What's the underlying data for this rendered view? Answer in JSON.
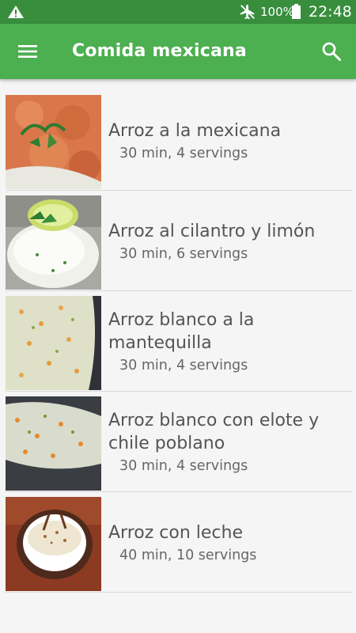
{
  "status_bar": {
    "battery_percent": "100%",
    "time": "22:48",
    "icons": [
      "warning-icon",
      "airplane-mode-icon",
      "battery-full-icon"
    ]
  },
  "app_bar": {
    "title": "Comida mexicana",
    "icons": [
      "menu-icon",
      "search-icon"
    ]
  },
  "colors": {
    "status_bar": "#388e3c",
    "app_bar": "#4caf50",
    "background": "#f5f5f5"
  },
  "recipes": [
    {
      "name": "Arroz a la mexicana",
      "meta": "30 min, 4 servings"
    },
    {
      "name": "Arroz al cilantro y limón",
      "meta": "30 min, 6 servings"
    },
    {
      "name": "Arroz blanco a la mantequilla",
      "meta": "30 min, 4 servings"
    },
    {
      "name": "Arroz blanco con elote y chile poblano",
      "meta": "30 min, 4 servings"
    },
    {
      "name": "Arroz con leche",
      "meta": "40 min, 10 servings"
    }
  ]
}
